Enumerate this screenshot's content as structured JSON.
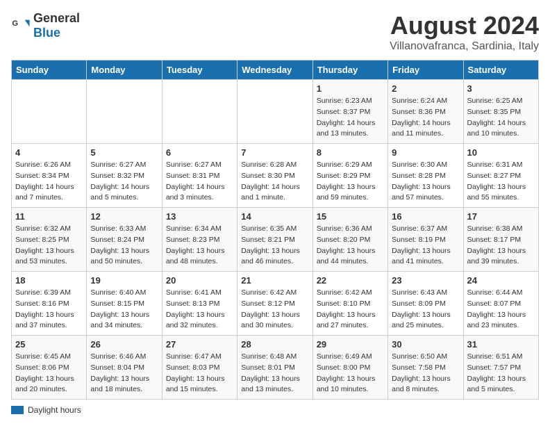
{
  "header": {
    "logo_general": "General",
    "logo_blue": "Blue",
    "title": "August 2024",
    "subtitle": "Villanovafranca, Sardinia, Italy"
  },
  "days_of_week": [
    "Sunday",
    "Monday",
    "Tuesday",
    "Wednesday",
    "Thursday",
    "Friday",
    "Saturday"
  ],
  "weeks": [
    [
      {
        "day": "",
        "info": ""
      },
      {
        "day": "",
        "info": ""
      },
      {
        "day": "",
        "info": ""
      },
      {
        "day": "",
        "info": ""
      },
      {
        "day": "1",
        "info": "Sunrise: 6:23 AM\nSunset: 8:37 PM\nDaylight: 14 hours\nand 13 minutes."
      },
      {
        "day": "2",
        "info": "Sunrise: 6:24 AM\nSunset: 8:36 PM\nDaylight: 14 hours\nand 11 minutes."
      },
      {
        "day": "3",
        "info": "Sunrise: 6:25 AM\nSunset: 8:35 PM\nDaylight: 14 hours\nand 10 minutes."
      }
    ],
    [
      {
        "day": "4",
        "info": "Sunrise: 6:26 AM\nSunset: 8:34 PM\nDaylight: 14 hours\nand 7 minutes."
      },
      {
        "day": "5",
        "info": "Sunrise: 6:27 AM\nSunset: 8:32 PM\nDaylight: 14 hours\nand 5 minutes."
      },
      {
        "day": "6",
        "info": "Sunrise: 6:27 AM\nSunset: 8:31 PM\nDaylight: 14 hours\nand 3 minutes."
      },
      {
        "day": "7",
        "info": "Sunrise: 6:28 AM\nSunset: 8:30 PM\nDaylight: 14 hours\nand 1 minute."
      },
      {
        "day": "8",
        "info": "Sunrise: 6:29 AM\nSunset: 8:29 PM\nDaylight: 13 hours\nand 59 minutes."
      },
      {
        "day": "9",
        "info": "Sunrise: 6:30 AM\nSunset: 8:28 PM\nDaylight: 13 hours\nand 57 minutes."
      },
      {
        "day": "10",
        "info": "Sunrise: 6:31 AM\nSunset: 8:27 PM\nDaylight: 13 hours\nand 55 minutes."
      }
    ],
    [
      {
        "day": "11",
        "info": "Sunrise: 6:32 AM\nSunset: 8:25 PM\nDaylight: 13 hours\nand 53 minutes."
      },
      {
        "day": "12",
        "info": "Sunrise: 6:33 AM\nSunset: 8:24 PM\nDaylight: 13 hours\nand 50 minutes."
      },
      {
        "day": "13",
        "info": "Sunrise: 6:34 AM\nSunset: 8:23 PM\nDaylight: 13 hours\nand 48 minutes."
      },
      {
        "day": "14",
        "info": "Sunrise: 6:35 AM\nSunset: 8:21 PM\nDaylight: 13 hours\nand 46 minutes."
      },
      {
        "day": "15",
        "info": "Sunrise: 6:36 AM\nSunset: 8:20 PM\nDaylight: 13 hours\nand 44 minutes."
      },
      {
        "day": "16",
        "info": "Sunrise: 6:37 AM\nSunset: 8:19 PM\nDaylight: 13 hours\nand 41 minutes."
      },
      {
        "day": "17",
        "info": "Sunrise: 6:38 AM\nSunset: 8:17 PM\nDaylight: 13 hours\nand 39 minutes."
      }
    ],
    [
      {
        "day": "18",
        "info": "Sunrise: 6:39 AM\nSunset: 8:16 PM\nDaylight: 13 hours\nand 37 minutes."
      },
      {
        "day": "19",
        "info": "Sunrise: 6:40 AM\nSunset: 8:15 PM\nDaylight: 13 hours\nand 34 minutes."
      },
      {
        "day": "20",
        "info": "Sunrise: 6:41 AM\nSunset: 8:13 PM\nDaylight: 13 hours\nand 32 minutes."
      },
      {
        "day": "21",
        "info": "Sunrise: 6:42 AM\nSunset: 8:12 PM\nDaylight: 13 hours\nand 30 minutes."
      },
      {
        "day": "22",
        "info": "Sunrise: 6:42 AM\nSunset: 8:10 PM\nDaylight: 13 hours\nand 27 minutes."
      },
      {
        "day": "23",
        "info": "Sunrise: 6:43 AM\nSunset: 8:09 PM\nDaylight: 13 hours\nand 25 minutes."
      },
      {
        "day": "24",
        "info": "Sunrise: 6:44 AM\nSunset: 8:07 PM\nDaylight: 13 hours\nand 23 minutes."
      }
    ],
    [
      {
        "day": "25",
        "info": "Sunrise: 6:45 AM\nSunset: 8:06 PM\nDaylight: 13 hours\nand 20 minutes."
      },
      {
        "day": "26",
        "info": "Sunrise: 6:46 AM\nSunset: 8:04 PM\nDaylight: 13 hours\nand 18 minutes."
      },
      {
        "day": "27",
        "info": "Sunrise: 6:47 AM\nSunset: 8:03 PM\nDaylight: 13 hours\nand 15 minutes."
      },
      {
        "day": "28",
        "info": "Sunrise: 6:48 AM\nSunset: 8:01 PM\nDaylight: 13 hours\nand 13 minutes."
      },
      {
        "day": "29",
        "info": "Sunrise: 6:49 AM\nSunset: 8:00 PM\nDaylight: 13 hours\nand 10 minutes."
      },
      {
        "day": "30",
        "info": "Sunrise: 6:50 AM\nSunset: 7:58 PM\nDaylight: 13 hours\nand 8 minutes."
      },
      {
        "day": "31",
        "info": "Sunrise: 6:51 AM\nSunset: 7:57 PM\nDaylight: 13 hours\nand 5 minutes."
      }
    ]
  ],
  "legend": {
    "daylight_hours": "Daylight hours"
  }
}
